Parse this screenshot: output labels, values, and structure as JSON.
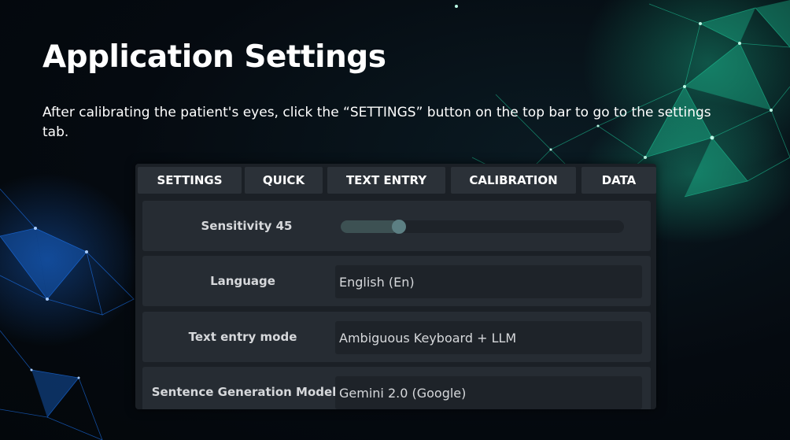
{
  "slide": {
    "title": "Application Settings",
    "instruction": "After calibrating the patient's eyes, click the “SETTINGS” button on the top bar to go to the settings tab."
  },
  "tabs": [
    {
      "label": "SETTINGS"
    },
    {
      "label": "QUICK"
    },
    {
      "label": "TEXT ENTRY"
    },
    {
      "label": "CALIBRATION"
    },
    {
      "label": "DATA"
    }
  ],
  "settings": {
    "sensitivity": {
      "label": "Sensitivity",
      "value": "45",
      "level": 0.18
    },
    "language": {
      "label": "Language",
      "value": "English (En)"
    },
    "text_entry_mode": {
      "label": "Text entry mode",
      "value": "Ambiguous Keyboard + LLM"
    },
    "sentence_model": {
      "label": "Sentence Generation Model",
      "value": "Gemini 2.0 (Google)"
    }
  },
  "colors": {
    "accent": "#5c7f83",
    "panel": "#1b2026",
    "row": "#262c33",
    "network_teal": "#1fd1a0",
    "network_blue": "#1e7bff"
  }
}
